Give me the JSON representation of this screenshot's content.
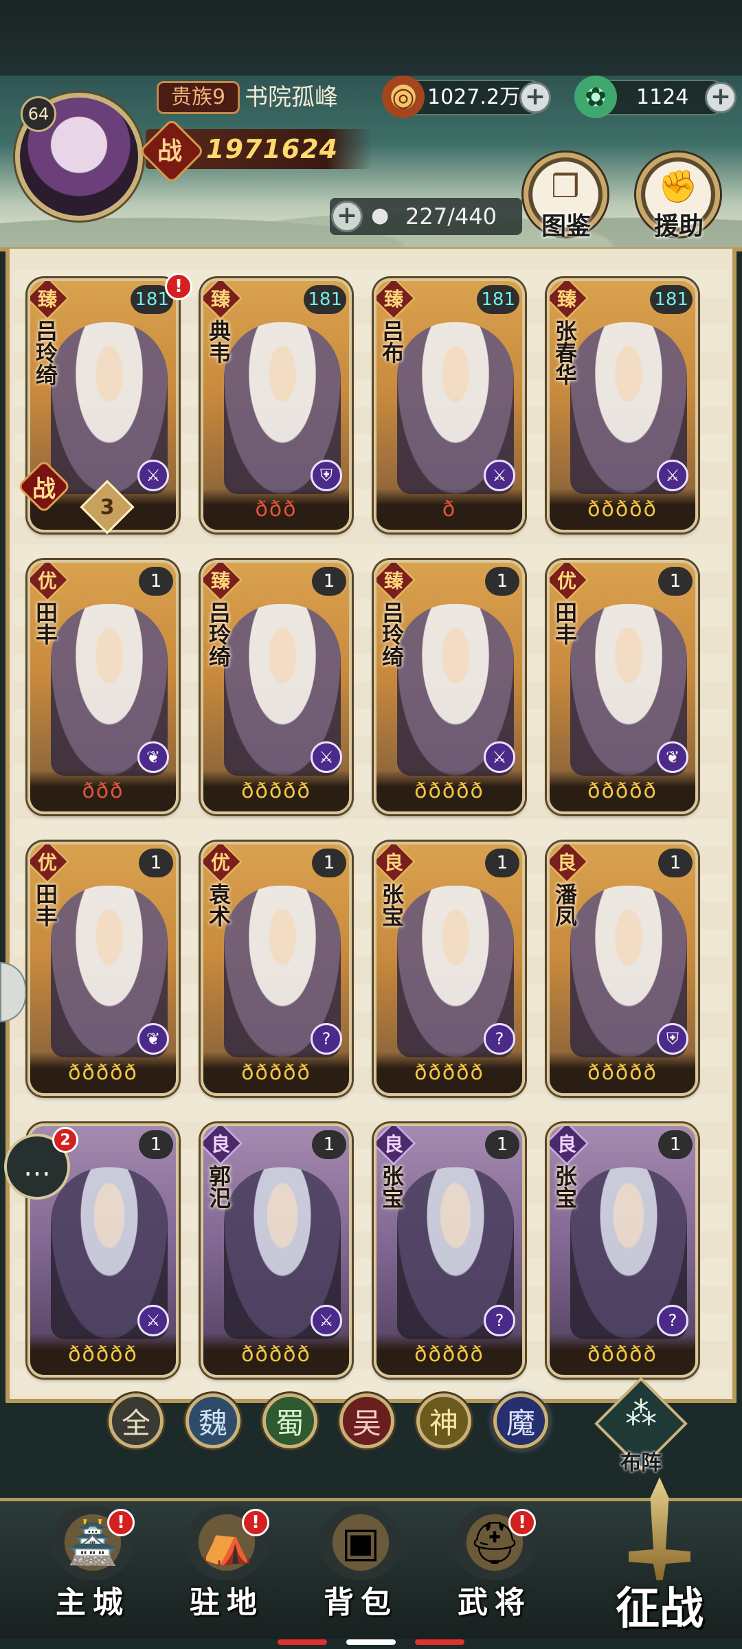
{
  "player": {
    "level": "64",
    "rank": "贵族9",
    "name": "书院孤峰",
    "power_icon": "战",
    "power": "1971624",
    "roster": "227/440"
  },
  "resources": {
    "coins": "1027.2万",
    "jade": "1124"
  },
  "shortcuts": {
    "codex": "图鉴",
    "support": "援助"
  },
  "cards": [
    {
      "grade": "臻",
      "name": "吕玲绮",
      "level": "181",
      "stars": "",
      "frame": "gold",
      "class_icon": "sword-icon",
      "alert": "!"
    },
    {
      "grade": "臻",
      "name": "典韦",
      "level": "181",
      "stars": "ððð",
      "frame": "gold",
      "class_icon": "shield-icon"
    },
    {
      "grade": "臻",
      "name": "吕布",
      "level": "181",
      "stars": "ð",
      "frame": "gold",
      "class_icon": "sword-icon"
    },
    {
      "grade": "臻",
      "name": "张春华",
      "level": "181",
      "stars": "ððððð",
      "frame": "gold",
      "class_icon": "sword-icon"
    },
    {
      "grade": "优",
      "name": "田丰",
      "level": "1",
      "stars": "ððð",
      "frame": "gold",
      "class_icon": "leaf-icon"
    },
    {
      "grade": "臻",
      "name": "吕玲绮",
      "level": "1",
      "stars": "ððððð",
      "frame": "gold",
      "class_icon": "sword-icon"
    },
    {
      "grade": "臻",
      "name": "吕玲绮",
      "level": "1",
      "stars": "ððððð",
      "frame": "gold",
      "class_icon": "sword-icon"
    },
    {
      "grade": "优",
      "name": "田丰",
      "level": "1",
      "stars": "ððððð",
      "frame": "gold",
      "class_icon": "leaf-icon"
    },
    {
      "grade": "优",
      "name": "田丰",
      "level": "1",
      "stars": "ððððð",
      "frame": "gold",
      "class_icon": "leaf-icon"
    },
    {
      "grade": "优",
      "name": "袁术",
      "level": "1",
      "stars": "ððððð",
      "frame": "gold",
      "class_icon": "staff-icon"
    },
    {
      "grade": "良",
      "name": "张宝",
      "level": "1",
      "stars": "ððððð",
      "frame": "gold",
      "class_icon": "staff-icon"
    },
    {
      "grade": "良",
      "name": "潘凤",
      "level": "1",
      "stars": "ððððð",
      "frame": "gold",
      "class_icon": "shield-icon"
    },
    {
      "grade": "",
      "name": "汜",
      "level": "1",
      "stars": "ððððð",
      "frame": "purple",
      "class_icon": "sword-icon"
    },
    {
      "grade": "良",
      "name": "郭汜",
      "level": "1",
      "stars": "ððððð",
      "frame": "purple",
      "class_icon": "sword-icon"
    },
    {
      "grade": "良",
      "name": "张宝",
      "level": "1",
      "stars": "ððððð",
      "frame": "purple",
      "class_icon": "staff-icon"
    },
    {
      "grade": "良",
      "name": "张宝",
      "level": "1",
      "stars": "ððððð",
      "frame": "purple",
      "class_icon": "staff-icon"
    }
  ],
  "first_card_extras": {
    "battle": "战",
    "slot": "3"
  },
  "filters": [
    "全",
    "魏",
    "蜀",
    "吴",
    "神",
    "魔"
  ],
  "formation_label": "布阵",
  "chat_badge": "2",
  "nav": [
    {
      "label": "主城",
      "icon": "castle-icon",
      "alert": "!"
    },
    {
      "label": "驻地",
      "icon": "camp-icon",
      "alert": "!"
    },
    {
      "label": "背包",
      "icon": "chest-icon"
    },
    {
      "label": "武将",
      "icon": "helmet-icon",
      "alert": "!"
    }
  ],
  "expedition_label": "征战"
}
